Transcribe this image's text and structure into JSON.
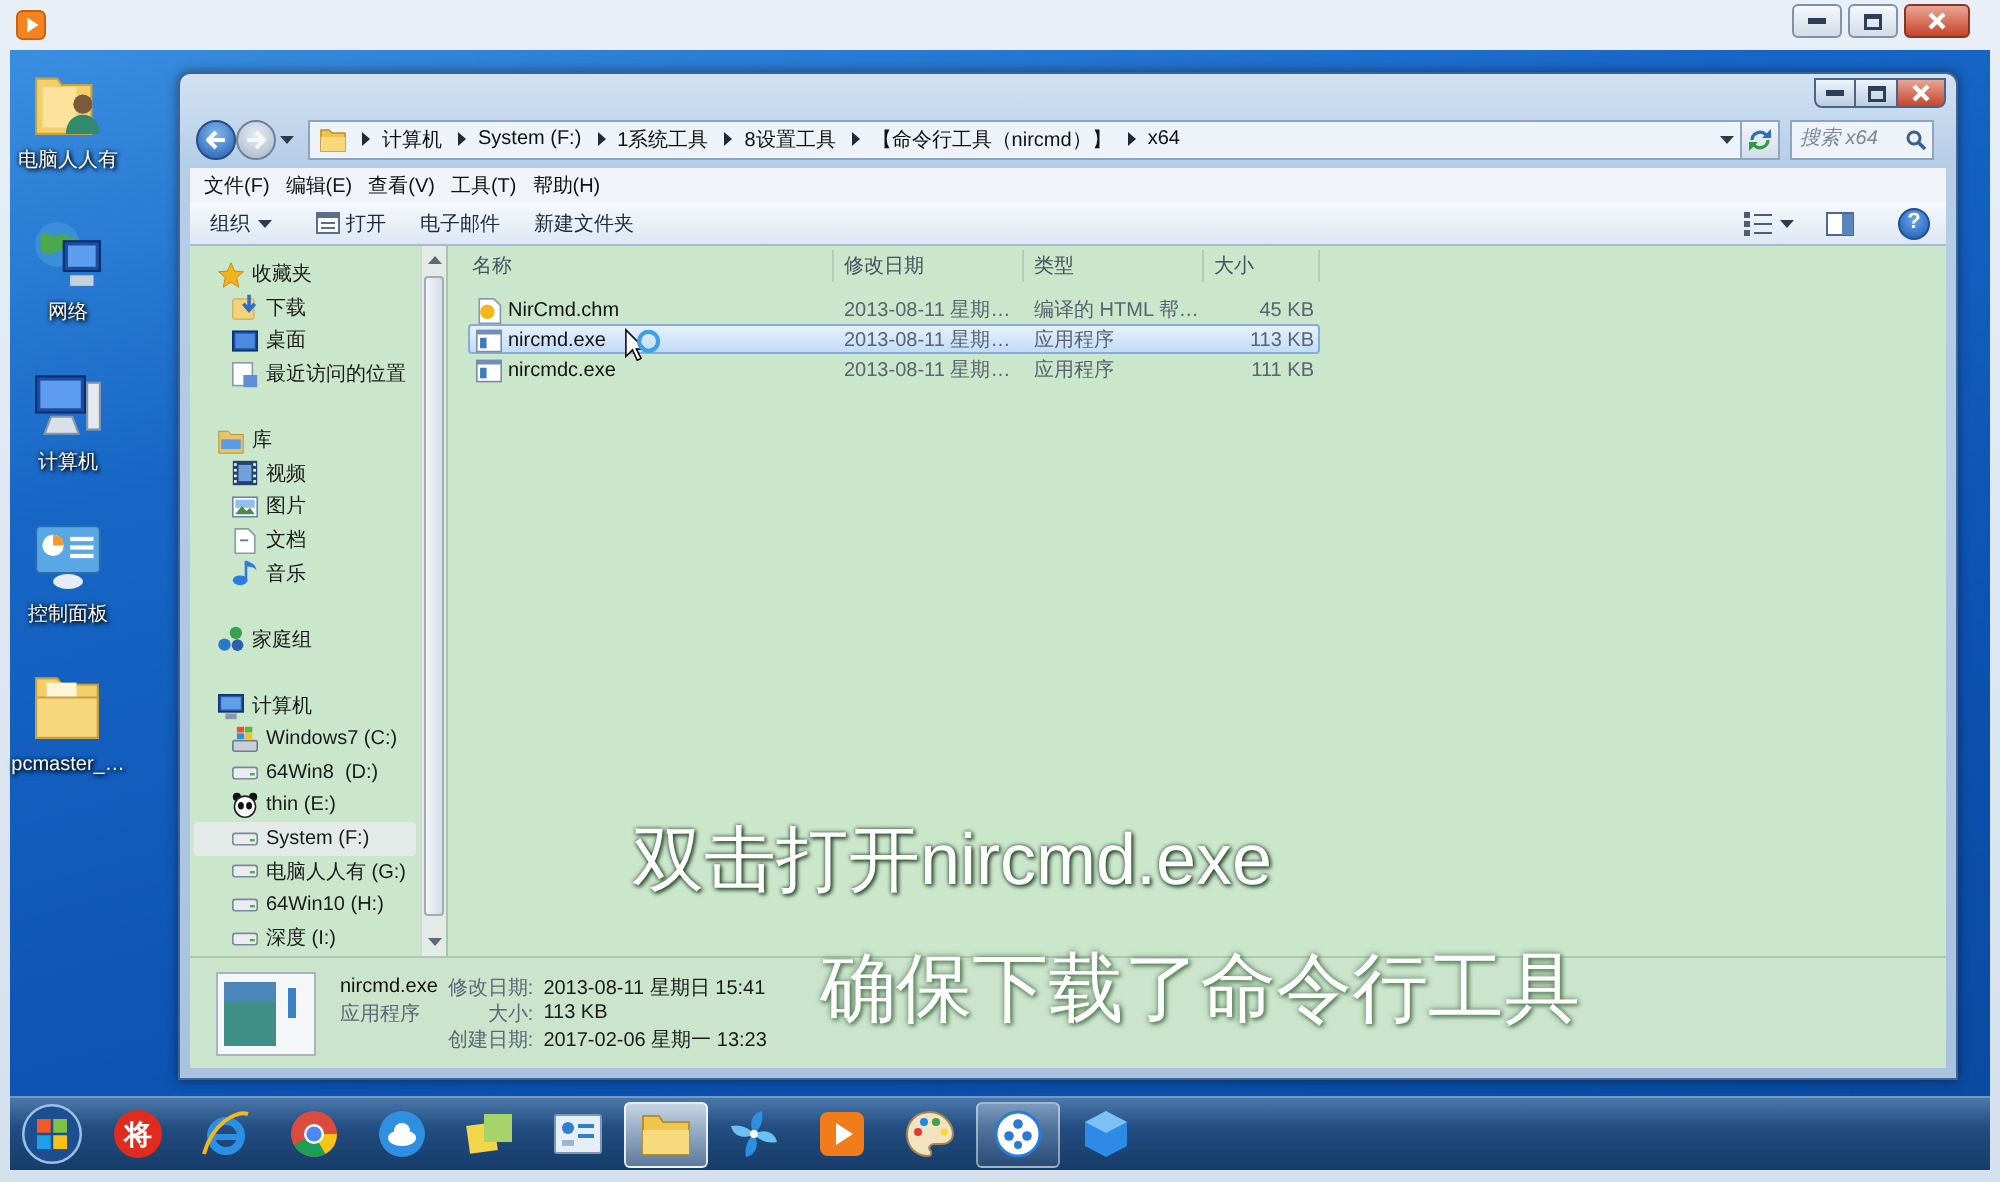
{
  "desktop_icons": [
    {
      "label": "电脑人人有",
      "kind": "user-folder"
    },
    {
      "label": "网络",
      "kind": "network"
    },
    {
      "label": "计算机",
      "kind": "computer"
    },
    {
      "label": "控制面板",
      "kind": "control-panel"
    },
    {
      "label": "pcmaster_…",
      "kind": "folder"
    }
  ],
  "explorer": {
    "breadcrumb": [
      "计算机",
      "System (F:)",
      "1系统工具",
      "8设置工具",
      "【命令行工具（nircmd）】",
      "x64"
    ],
    "search": {
      "placeholder": "搜索 x64"
    },
    "menu": [
      "文件(F)",
      "编辑(E)",
      "查看(V)",
      "工具(T)",
      "帮助(H)"
    ],
    "toolbar": [
      {
        "label": "组织",
        "kind": "menu"
      },
      {
        "label": "打开",
        "kind": "icon"
      },
      {
        "label": "电子邮件",
        "kind": "plain"
      },
      {
        "label": "新建文件夹",
        "kind": "plain"
      }
    ],
    "help_button": "?",
    "nav": [
      {
        "label": "收藏夹",
        "kind": "star",
        "selected": false,
        "children": [
          {
            "label": "下载",
            "kind": "download",
            "selected": false
          },
          {
            "label": "桌面",
            "kind": "desktop",
            "selected": false
          },
          {
            "label": "最近访问的位置",
            "kind": "recent",
            "selected": false
          }
        ]
      },
      {
        "label": "库",
        "kind": "library",
        "selected": false,
        "children": [
          {
            "label": "视频",
            "kind": "video",
            "selected": false
          },
          {
            "label": "图片",
            "kind": "picture",
            "selected": false
          },
          {
            "label": "文档",
            "kind": "document",
            "selected": false
          },
          {
            "label": "音乐",
            "kind": "music",
            "selected": false
          }
        ]
      },
      {
        "label": "家庭组",
        "kind": "homegroup",
        "selected": false
      },
      {
        "label": "计算机",
        "kind": "computer",
        "selected": false,
        "children": [
          {
            "label": "Windows7 (C:)",
            "kind": "system-drive",
            "selected": false
          },
          {
            "label": "64Win8  (D:)",
            "kind": "drive",
            "selected": false
          },
          {
            "label": "thin (E:)",
            "kind": "panda",
            "selected": false
          },
          {
            "label": "System (F:)",
            "kind": "drive",
            "selected": true
          },
          {
            "label": "电脑人人有 (G:)",
            "kind": "drive",
            "selected": false
          },
          {
            "label": "64Win10 (H:)",
            "kind": "drive",
            "selected": false
          },
          {
            "label": "深度 (I:)",
            "kind": "drive",
            "selected": false
          }
        ]
      }
    ],
    "columns": [
      "名称",
      "修改日期",
      "类型",
      "大小"
    ],
    "files": [
      {
        "name": "NirCmd.chm",
        "kind": "help",
        "modified": "2013-08-11 星期…",
        "type": "编译的 HTML 帮…",
        "size": "45 KB",
        "selected": false
      },
      {
        "name": "nircmd.exe",
        "kind": "app",
        "modified": "2013-08-11 星期…",
        "type": "应用程序",
        "size": "113 KB",
        "selected": true
      },
      {
        "name": "nircmdc.exe",
        "kind": "app",
        "modified": "2013-08-11 星期…",
        "type": "应用程序",
        "size": "111 KB",
        "selected": false
      }
    ],
    "details": {
      "name": "nircmd.exe",
      "type": "应用程序",
      "fields": [
        {
          "label": "修改日期:",
          "value": "2013-08-11 星期日 15:41"
        },
        {
          "label": "大小:",
          "value": "113 KB"
        },
        {
          "label": "创建日期:",
          "value": "2017-02-06 星期一 13:23"
        }
      ]
    }
  },
  "captions": [
    {
      "text": "双击打开nircmd.exe",
      "kind": "main"
    },
    {
      "text": "确保下载了命令行工具",
      "kind": "faded"
    }
  ],
  "taskbar": {
    "apps": [
      {
        "kind": "badge",
        "label": "将",
        "selected": false,
        "running": false
      },
      {
        "kind": "ring",
        "selected": false,
        "running": false
      },
      {
        "kind": "tricolor",
        "selected": false,
        "running": false
      },
      {
        "kind": "cloud",
        "selected": false,
        "running": false
      },
      {
        "kind": "notes",
        "selected": false,
        "running": false
      },
      {
        "kind": "panel",
        "selected": false,
        "running": false
      },
      {
        "kind": "folder",
        "selected": true,
        "running": true
      },
      {
        "kind": "pinwheel",
        "selected": false,
        "running": false
      },
      {
        "kind": "player",
        "selected": false,
        "running": false
      },
      {
        "kind": "palette",
        "selected": false,
        "running": false
      },
      {
        "kind": "film",
        "selected": false,
        "running": true
      },
      {
        "kind": "cube",
        "selected": false,
        "running": false
      }
    ]
  }
}
